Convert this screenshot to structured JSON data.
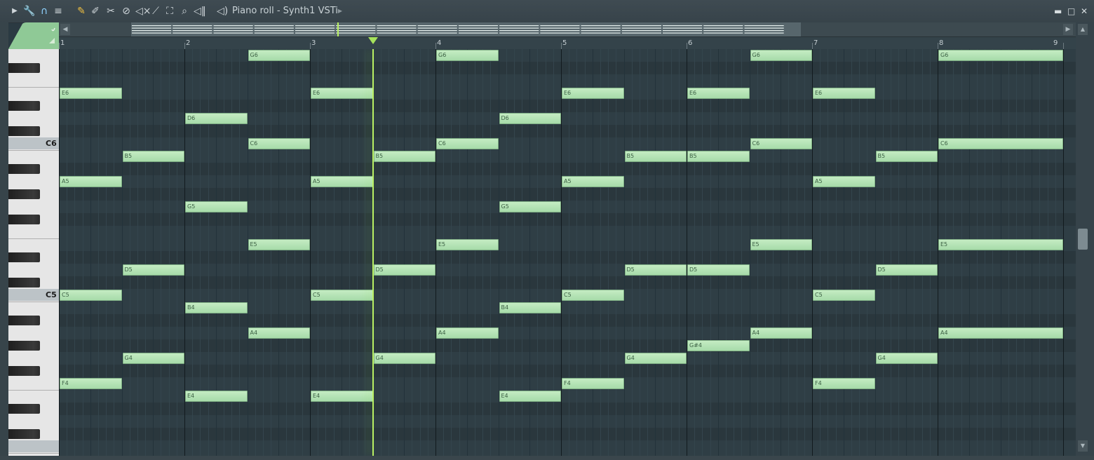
{
  "window": {
    "title": "Piano roll - Synth1 VSTi",
    "controls": {
      "minimize": "▬",
      "maximize": "□",
      "close": "✕"
    }
  },
  "toolbar": {
    "tools": [
      "arrow-icon",
      "wrench-icon",
      "magnet-icon",
      "menu-icon",
      "pencil-icon",
      "paint-icon",
      "delete-icon",
      "mute-icon",
      "speaker-mute-icon",
      "slice-icon",
      "select-icon",
      "zoom-icon",
      "playback-icon"
    ]
  },
  "ruler": {
    "bars": [
      "1",
      "2",
      "3",
      "4",
      "5",
      "6",
      "7",
      "8",
      "9"
    ]
  },
  "keyboard": {
    "labels": [
      "C6",
      "C5"
    ]
  },
  "colors": {
    "note_fill": "#b4e2b4",
    "playhead": "#b9f063",
    "key_highlight": "#f5b878",
    "grid_bg": "#2f3e45"
  },
  "notes": [
    {
      "pitch": "E6",
      "start": 1.0,
      "dur": 0.5
    },
    {
      "pitch": "A5",
      "start": 1.0,
      "dur": 0.5
    },
    {
      "pitch": "C5",
      "start": 1.0,
      "dur": 0.5
    },
    {
      "pitch": "F4",
      "start": 1.0,
      "dur": 0.5
    },
    {
      "pitch": "B5",
      "start": 1.5,
      "dur": 0.5
    },
    {
      "pitch": "D5",
      "start": 1.5,
      "dur": 0.5
    },
    {
      "pitch": "G4",
      "start": 1.5,
      "dur": 0.5
    },
    {
      "pitch": "D6",
      "start": 2.0,
      "dur": 0.5
    },
    {
      "pitch": "G5",
      "start": 2.0,
      "dur": 0.5
    },
    {
      "pitch": "B4",
      "start": 2.0,
      "dur": 0.5
    },
    {
      "pitch": "E4",
      "start": 2.0,
      "dur": 0.5
    },
    {
      "pitch": "G6",
      "start": 2.5,
      "dur": 0.5
    },
    {
      "pitch": "C6",
      "start": 2.5,
      "dur": 0.5
    },
    {
      "pitch": "E5",
      "start": 2.5,
      "dur": 0.5
    },
    {
      "pitch": "A4",
      "start": 2.5,
      "dur": 0.5
    },
    {
      "pitch": "E6",
      "start": 3.0,
      "dur": 0.5
    },
    {
      "pitch": "A5",
      "start": 3.0,
      "dur": 0.5
    },
    {
      "pitch": "C5",
      "start": 3.0,
      "dur": 0.5
    },
    {
      "pitch": "E4",
      "start": 3.0,
      "dur": 0.5
    },
    {
      "pitch": "B5",
      "start": 3.5,
      "dur": 0.5
    },
    {
      "pitch": "D5",
      "start": 3.5,
      "dur": 0.5
    },
    {
      "pitch": "G4",
      "start": 3.5,
      "dur": 0.5
    },
    {
      "pitch": "G6",
      "start": 4.0,
      "dur": 0.5
    },
    {
      "pitch": "C6",
      "start": 4.0,
      "dur": 0.5
    },
    {
      "pitch": "E5",
      "start": 4.0,
      "dur": 0.5
    },
    {
      "pitch": "A4",
      "start": 4.0,
      "dur": 0.5
    },
    {
      "pitch": "D6",
      "start": 4.5,
      "dur": 0.5
    },
    {
      "pitch": "G5",
      "start": 4.5,
      "dur": 0.5
    },
    {
      "pitch": "B4",
      "start": 4.5,
      "dur": 0.5
    },
    {
      "pitch": "E4",
      "start": 4.5,
      "dur": 0.5
    },
    {
      "pitch": "E6",
      "start": 5.0,
      "dur": 0.5
    },
    {
      "pitch": "A5",
      "start": 5.0,
      "dur": 0.5
    },
    {
      "pitch": "C5",
      "start": 5.0,
      "dur": 0.5
    },
    {
      "pitch": "F4",
      "start": 5.0,
      "dur": 0.5
    },
    {
      "pitch": "B5",
      "start": 5.5,
      "dur": 0.5
    },
    {
      "pitch": "D5",
      "start": 5.5,
      "dur": 0.5
    },
    {
      "pitch": "G4",
      "start": 5.5,
      "dur": 0.5
    },
    {
      "pitch": "E6",
      "start": 6.0,
      "dur": 0.5
    },
    {
      "pitch": "B5",
      "start": 6.0,
      "dur": 0.5
    },
    {
      "pitch": "D5",
      "start": 6.0,
      "dur": 0.5
    },
    {
      "pitch": "G#4",
      "start": 6.0,
      "dur": 0.5
    },
    {
      "pitch": "G6",
      "start": 6.5,
      "dur": 0.5
    },
    {
      "pitch": "C6",
      "start": 6.5,
      "dur": 0.5
    },
    {
      "pitch": "E5",
      "start": 6.5,
      "dur": 0.5
    },
    {
      "pitch": "A4",
      "start": 6.5,
      "dur": 0.5
    },
    {
      "pitch": "E6",
      "start": 7.0,
      "dur": 0.5
    },
    {
      "pitch": "A5",
      "start": 7.0,
      "dur": 0.5
    },
    {
      "pitch": "C5",
      "start": 7.0,
      "dur": 0.5
    },
    {
      "pitch": "F4",
      "start": 7.0,
      "dur": 0.5
    },
    {
      "pitch": "B5",
      "start": 7.5,
      "dur": 0.5
    },
    {
      "pitch": "D5",
      "start": 7.5,
      "dur": 0.5
    },
    {
      "pitch": "G4",
      "start": 7.5,
      "dur": 0.5
    },
    {
      "pitch": "G6",
      "start": 8.0,
      "dur": 1.0
    },
    {
      "pitch": "C6",
      "start": 8.0,
      "dur": 1.0
    },
    {
      "pitch": "E5",
      "start": 8.0,
      "dur": 1.0
    },
    {
      "pitch": "A4",
      "start": 8.0,
      "dur": 1.0
    }
  ],
  "playhead_bar": 3.5
}
